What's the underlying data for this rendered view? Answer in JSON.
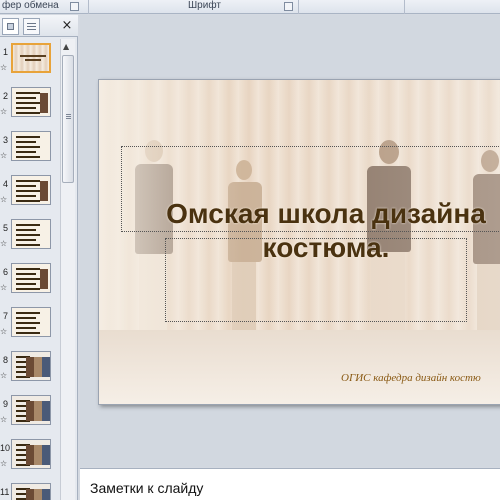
{
  "ribbon": {
    "clipboard_group": "фер обмена",
    "font_group": "Шрифт"
  },
  "panel": {
    "close_glyph": "×",
    "slides": [
      {
        "number": "1",
        "selected": true
      },
      {
        "number": "2"
      },
      {
        "number": "3"
      },
      {
        "number": "4"
      },
      {
        "number": "5"
      },
      {
        "number": "6"
      },
      {
        "number": "7"
      },
      {
        "number": "8"
      },
      {
        "number": "9"
      },
      {
        "number": "10"
      },
      {
        "number": "11"
      }
    ],
    "star_glyph": "☆"
  },
  "slide": {
    "title_line1": "Омская школа дизайна",
    "title_line2": "костюма.",
    "footer": "ОГИС кафедра дизайн костю"
  },
  "notes": {
    "placeholder": "Заметки к слайду"
  },
  "colors": {
    "title": "#4a3210",
    "footer": "#8a5a14",
    "selected_thumb_border": "#e8a33a"
  }
}
